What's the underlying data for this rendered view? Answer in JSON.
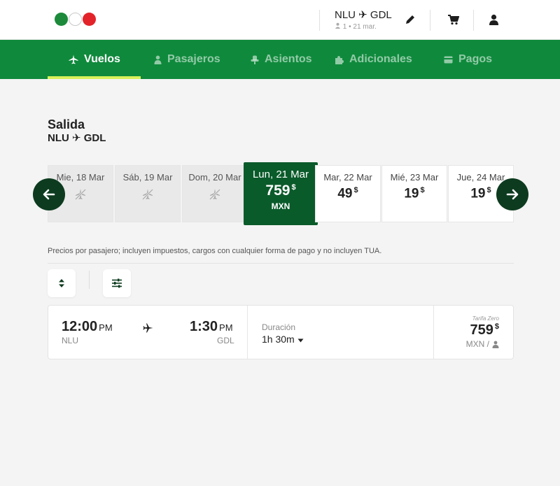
{
  "header": {
    "route": "NLU ✈ GDL",
    "passengers": "1",
    "date": "21 mar.",
    "icons": [
      "pencil-icon",
      "cart-icon",
      "user-icon"
    ]
  },
  "nav": {
    "items": [
      {
        "label": "Vuelos",
        "icon": "plane-icon",
        "active": true
      },
      {
        "label": "Pasajeros",
        "icon": "person-icon",
        "active": false
      },
      {
        "label": "Asientos",
        "icon": "seat-icon",
        "active": false
      },
      {
        "label": "Adicionales",
        "icon": "puzzle-icon",
        "active": false
      },
      {
        "label": "Pagos",
        "icon": "card-icon",
        "active": false
      }
    ]
  },
  "page": {
    "title": "Salida",
    "route": "NLU ✈ GDL",
    "note": "Precios por pasajero; incluyen impuestos, cargos con cualquier forma de pago y no incluyen TUA."
  },
  "dates": [
    {
      "label": "Mie, 18 Mar",
      "price": "",
      "available": false
    },
    {
      "label": "Sáb, 19 Mar",
      "price": "",
      "available": false
    },
    {
      "label": "Dom, 20 Mar",
      "price": "",
      "available": false
    },
    {
      "label": "Lun, 21 Mar",
      "price": "759",
      "currency_symbol": "$",
      "currency": "MXN",
      "available": true,
      "selected": true
    },
    {
      "label": "Mar, 22 Mar",
      "price": "49",
      "currency_symbol": "$",
      "available": true
    },
    {
      "label": "Mié, 23 Mar",
      "price": "19",
      "currency_symbol": "$",
      "available": true
    },
    {
      "label": "Jue, 24 Mar",
      "price": "19",
      "currency_symbol": "$",
      "available": true
    }
  ],
  "flight": {
    "depart_time": "12:00",
    "depart_period": "PM",
    "depart_code": "NLU",
    "arrive_time": "1:30",
    "arrive_period": "PM",
    "arrive_code": "GDL",
    "duration_label": "Duración",
    "duration": "1h 30m",
    "fare_name": "Tarifa Zero",
    "price": "759",
    "currency_symbol": "$",
    "price_unit": "MXN /"
  },
  "colors": {
    "brand_green": "#0f8a3c",
    "selected_day": "#0a5b2a",
    "arrow_bg": "#0d3b1f",
    "nav_underline": "#d9f05a"
  }
}
